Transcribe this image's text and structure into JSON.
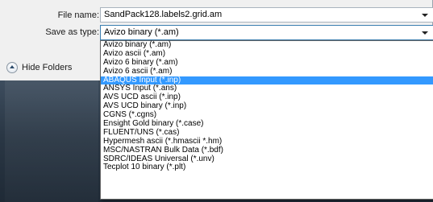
{
  "file_name": {
    "label": "File name:",
    "value": "SandPack128.labels2.grid.am"
  },
  "save_as_type": {
    "label": "Save as type:",
    "value": "Avizo binary (*.am)"
  },
  "hide_folders": {
    "label": "Hide Folders"
  },
  "dropdown": {
    "selected_index": 4,
    "options": [
      "Avizo binary (*.am)",
      "Avizo ascii (*.am)",
      "Avizo 6 binary (*.am)",
      "Avizo 6 ascii (*.am)",
      "ABAQUS Input (*.inp)",
      "ANSYS Input (*.ans)",
      "AVS UCD ascii (*.inp)",
      "AVS UCD binary (*.inp)",
      "CGNS (*.cgns)",
      "Ensight Gold binary (*.case)",
      "FLUENT/UNS (*.cas)",
      "Hypermesh ascii (*.hmascii *.hm)",
      "MSC/NASTRAN Bulk Data (*.bdf)",
      "SDRC/IDEAS Universal (*.unv)",
      "Tecplot 10 binary (*.plt)"
    ]
  },
  "colors": {
    "highlight": "#3399ff",
    "dialog_background": "#f0f0f0",
    "window_frame": "#2b3a4a"
  }
}
